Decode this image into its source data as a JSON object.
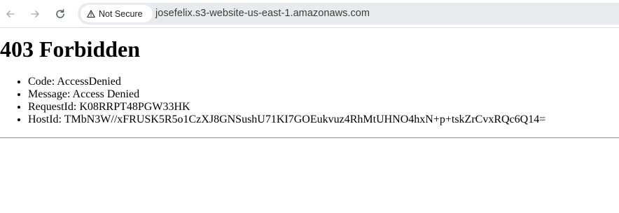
{
  "browser": {
    "security_label": "Not Secure",
    "url": "josefelix.s3-website-us-east-1.amazonaws.com",
    "icons": [
      "back-arrow-icon",
      "forward-arrow-icon",
      "reload-icon",
      "warning-icon"
    ]
  },
  "page": {
    "title": "403 Forbidden",
    "items": [
      "Code: AccessDenied",
      "Message: Access Denied",
      "RequestId: K08RRPT48PGW33HK",
      "HostId: TMbN3W//xFRUSK5R5o1CzXJ8GNSushU71KI7GOEukvuz4RhMtUHNO4hxN+p+tskZrCvxRQc6Q14="
    ]
  }
}
